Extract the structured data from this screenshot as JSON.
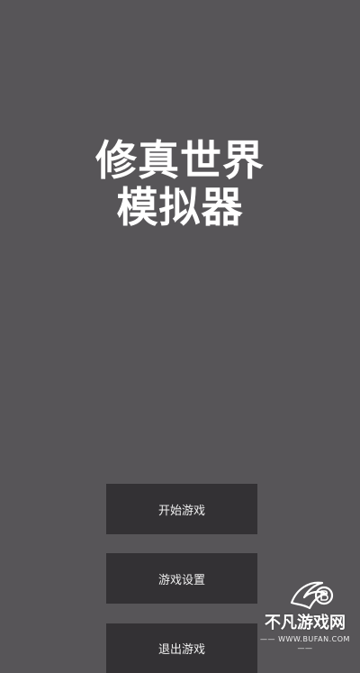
{
  "game": {
    "title_line1": "修真世界",
    "title_line2": "模拟器"
  },
  "menu": {
    "start_label": "开始游戏",
    "settings_label": "游戏设置",
    "exit_label": "退出游戏"
  },
  "watermark": {
    "site_name": "不凡游戏网",
    "site_url": "—— WWW.BUFAN.COM ——"
  },
  "colors": {
    "background": "#575558",
    "button": "#333134",
    "text": "#ffffff"
  }
}
